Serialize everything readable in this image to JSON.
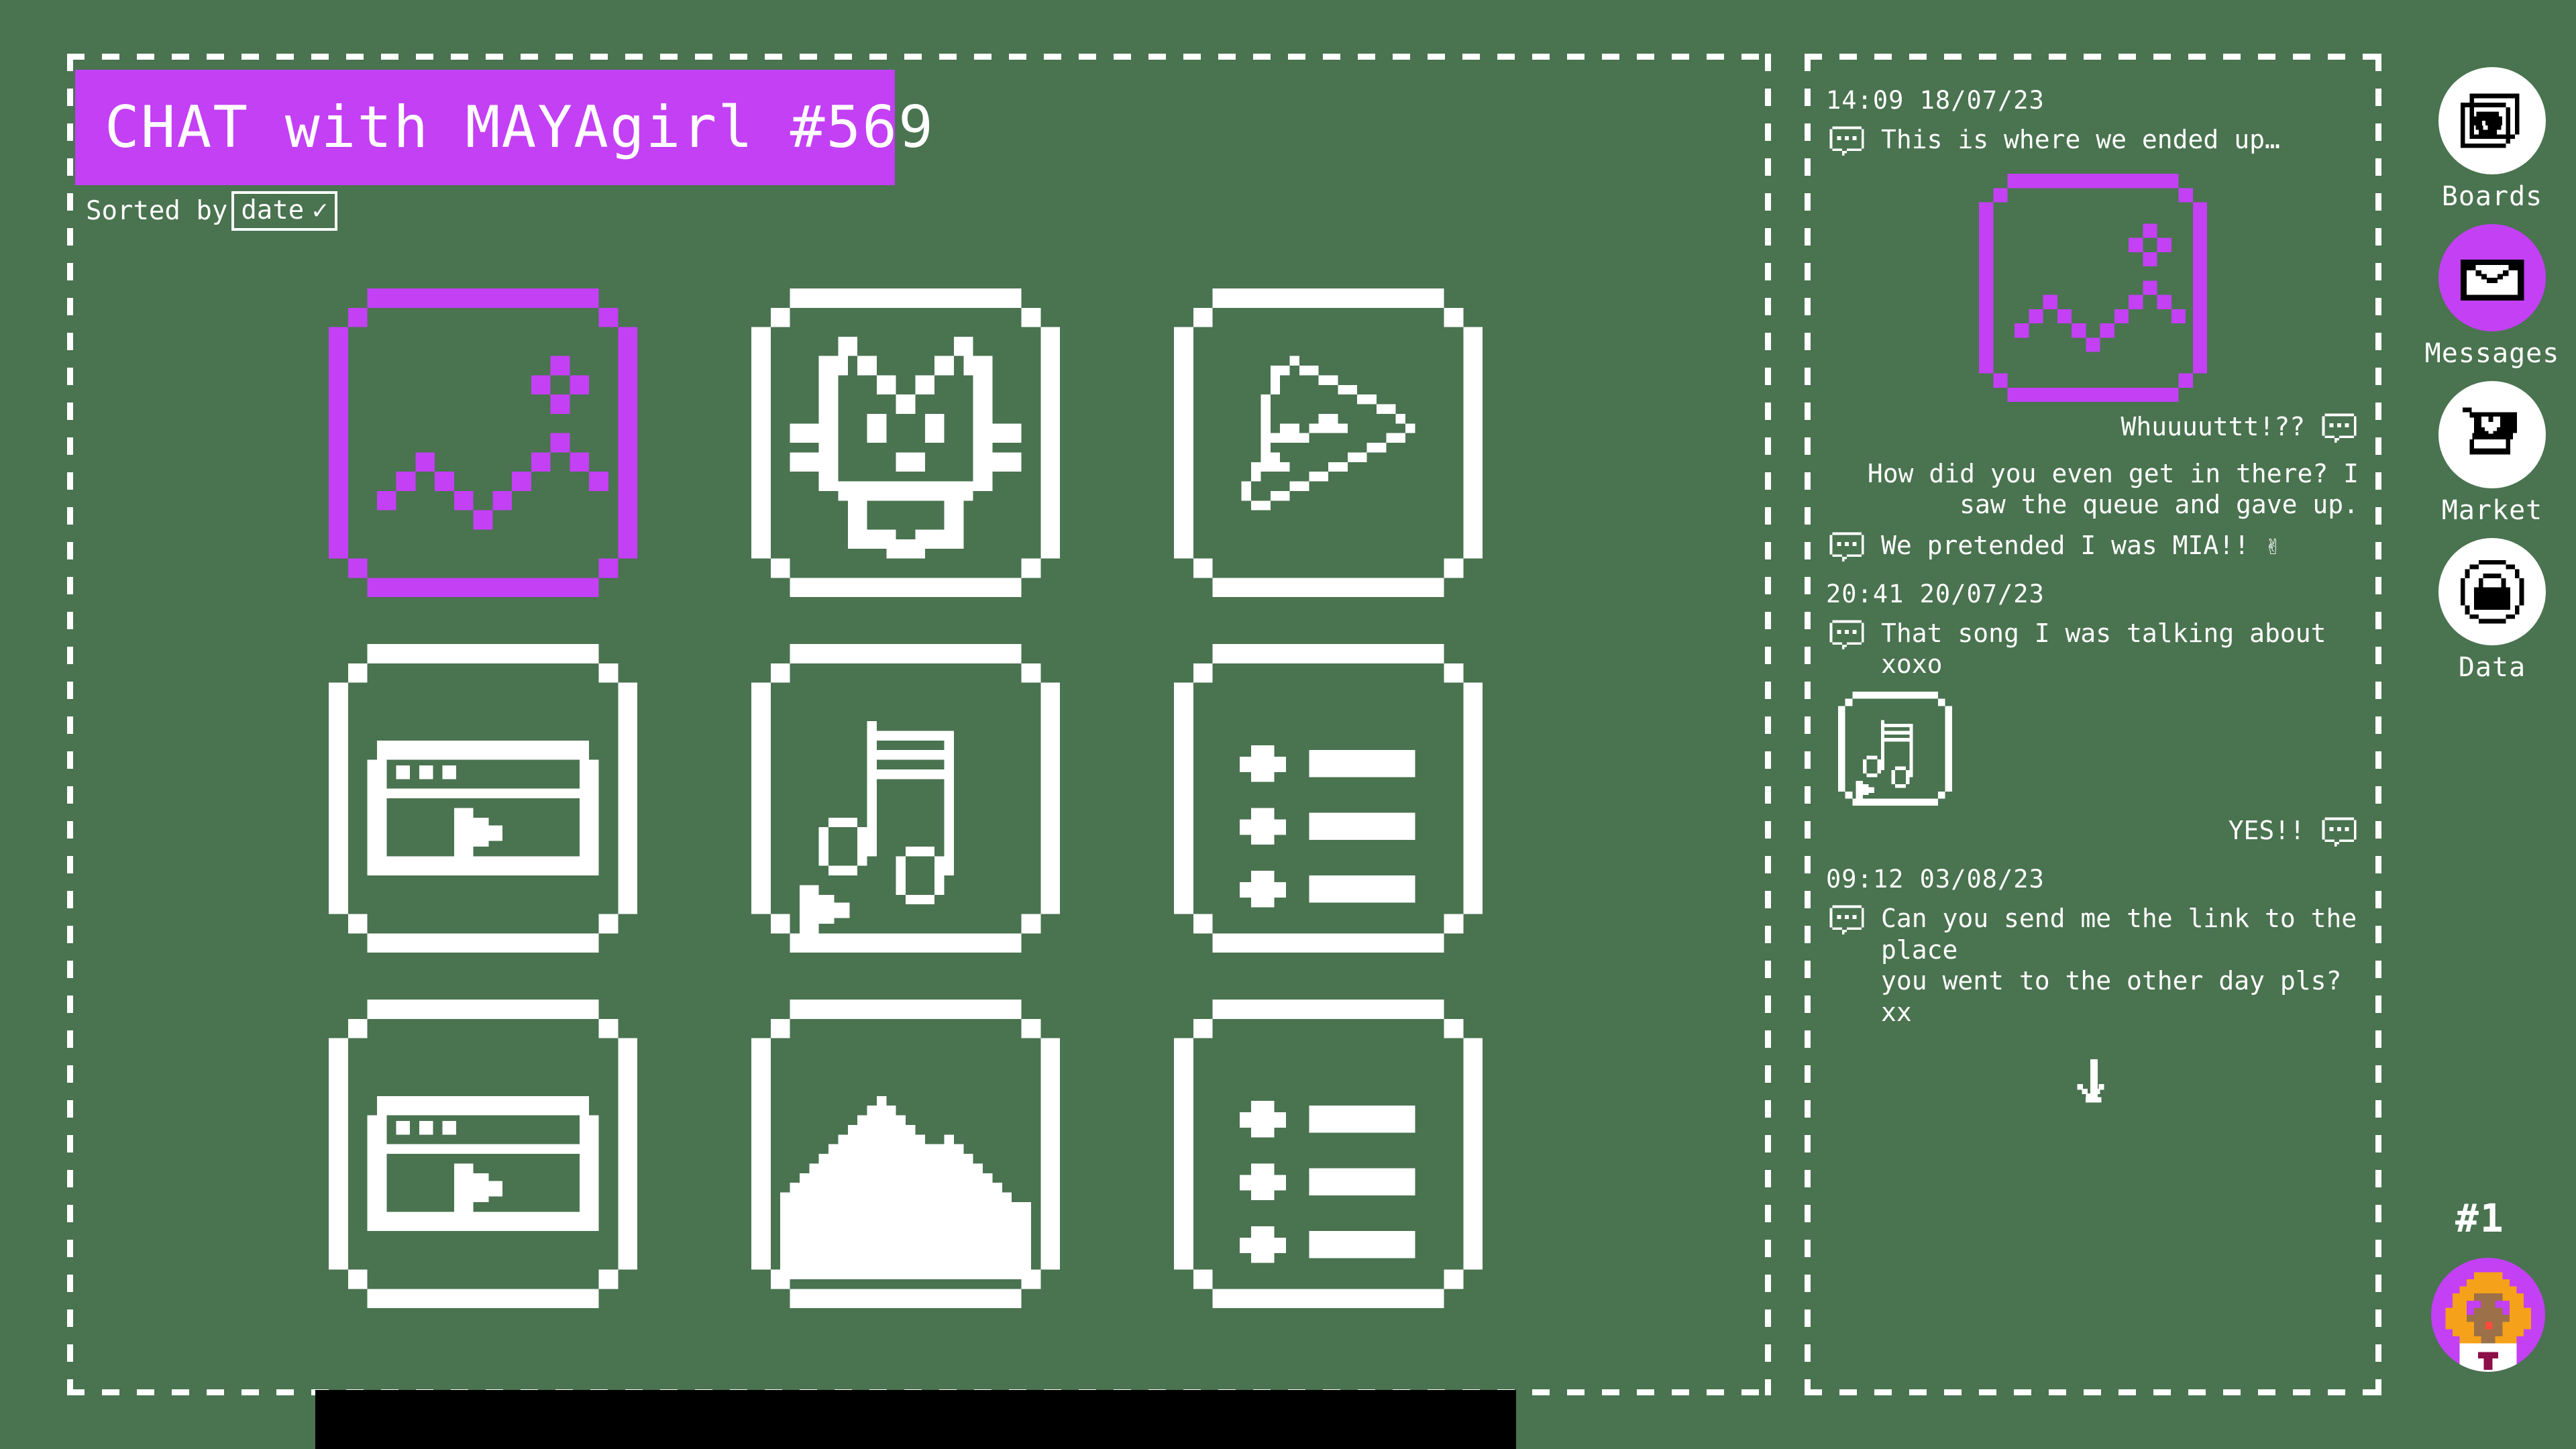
{
  "theme": {
    "background": "#4a7350",
    "accent": "#c340f5",
    "foreground": "#ffffff",
    "bar": "#000000"
  },
  "header": {
    "title": "CHAT with MAYAgirl #569",
    "sort_label": "Sorted by",
    "sort_value": "date",
    "sort_check": "✓"
  },
  "gallery": {
    "tiles": [
      {
        "id": "tile-1",
        "kind": "image-landscape",
        "selected": true,
        "alt": "landscape photo"
      },
      {
        "id": "tile-2",
        "kind": "image-cat",
        "selected": false,
        "alt": "cat photo"
      },
      {
        "id": "tile-3",
        "kind": "image-pizza",
        "selected": false,
        "alt": "pizza photo"
      },
      {
        "id": "tile-4",
        "kind": "video-window",
        "selected": false,
        "alt": "video clip"
      },
      {
        "id": "tile-5",
        "kind": "audio-note",
        "selected": false,
        "alt": "audio clip"
      },
      {
        "id": "tile-6",
        "kind": "list-doc",
        "selected": false,
        "alt": "list document"
      },
      {
        "id": "tile-7",
        "kind": "video-window",
        "selected": false,
        "alt": "video clip"
      },
      {
        "id": "tile-8",
        "kind": "image-mountains",
        "selected": false,
        "alt": "mountains photo"
      },
      {
        "id": "tile-9",
        "kind": "list-doc",
        "selected": false,
        "alt": "list document"
      }
    ]
  },
  "chat": {
    "entries": [
      {
        "type": "stamp",
        "text": "14:09 18/07/23"
      },
      {
        "type": "message",
        "side": "them",
        "text": "This is where we ended up…"
      },
      {
        "type": "image",
        "align": "center",
        "kind": "image-landscape",
        "accent": true
      },
      {
        "type": "message",
        "side": "me",
        "text": "Whuuuuttt!??"
      },
      {
        "type": "text",
        "side": "me",
        "text": "How did you even get in there? I\nsaw the queue and gave up."
      },
      {
        "type": "message",
        "side": "them",
        "text": "We pretended I was MIA!! ✌"
      },
      {
        "type": "stamp",
        "text": "20:41 20/07/23"
      },
      {
        "type": "message",
        "side": "them",
        "text": "That song I was talking about xoxo"
      },
      {
        "type": "image",
        "align": "left",
        "kind": "audio-note",
        "accent": false
      },
      {
        "type": "message",
        "side": "me",
        "text": "YES!!"
      },
      {
        "type": "stamp",
        "text": "09:12 03/08/23"
      },
      {
        "type": "message",
        "side": "them",
        "text": "Can you send me the link to the place\nyou went to the other day pls? xx"
      },
      {
        "type": "scroll-indicator",
        "icon": "arrow-down-icon"
      }
    ]
  },
  "nav": {
    "items": [
      {
        "id": "boards",
        "label": "Boards",
        "icon": "photos-globe-icon",
        "active": false
      },
      {
        "id": "messages",
        "label": "Messages",
        "icon": "envelope-icon",
        "active": true
      },
      {
        "id": "market",
        "label": "Market",
        "icon": "cart-heart-icon",
        "active": false
      },
      {
        "id": "data",
        "label": "Data",
        "icon": "lock-circle-icon",
        "active": false
      }
    ],
    "rank": "#1"
  }
}
